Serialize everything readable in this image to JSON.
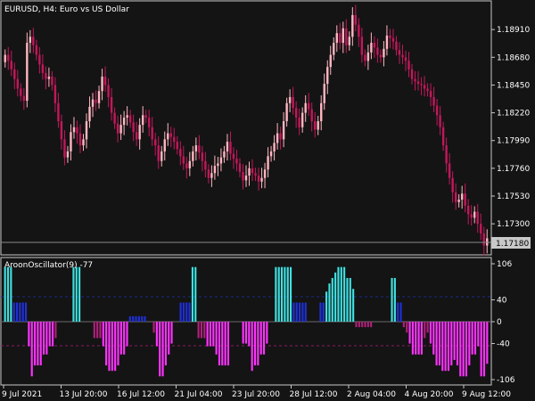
{
  "symbol_label": "EURUSD, H4:  Euro vs US Dollar",
  "indicator_label": "AroonOscillator(9) -77",
  "current_price": "1.17180",
  "colors": {
    "background": "#141414",
    "axis": "#c8c8c8",
    "candle_bull": "#ffb6c1",
    "candle_bear": "#c2185b",
    "osc_strong_up": "#40e0e0",
    "osc_up": "#1f30d8",
    "osc_down": "#ff33ff",
    "osc_weak_down": "#b0207a",
    "level_up": "#1a2a8a",
    "level_down": "#8a1a6a"
  },
  "chart_data": [
    {
      "type": "candlestick",
      "title": "",
      "price_ticks": [
        "1.18910",
        "1.18680",
        "1.18450",
        "1.18220",
        "1.17990",
        "1.17760",
        "1.17530",
        "1.17300"
      ],
      "ylim": [
        1.1705,
        1.1914
      ],
      "x_ticks": [
        "9 Jul 2021",
        "13 Jul 20:00",
        "16 Jul 12:00",
        "21 Jul 04:00",
        "23 Jul 20:00",
        "28 Jul 12:00",
        "2 Aug 04:00",
        "4 Aug 20:00",
        "9 Aug 12:00"
      ],
      "close": [
        1.187,
        1.1865,
        1.1858,
        1.185,
        1.1842,
        1.1836,
        1.1832,
        1.188,
        1.1885,
        1.1878,
        1.187,
        1.1862,
        1.1855,
        1.185,
        1.1852,
        1.1845,
        1.183,
        1.1815,
        1.18,
        1.1785,
        1.179,
        1.1806,
        1.181,
        1.1805,
        1.1795,
        1.18,
        1.1815,
        1.1827,
        1.1833,
        1.183,
        1.184,
        1.1852,
        1.1845,
        1.1835,
        1.1822,
        1.1813,
        1.1805,
        1.1812,
        1.1818,
        1.182,
        1.1814,
        1.1806,
        1.18,
        1.1812,
        1.182,
        1.1818,
        1.181,
        1.18,
        1.1795,
        1.1782,
        1.179,
        1.18,
        1.1805,
        1.1802,
        1.1798,
        1.1792,
        1.1786,
        1.178,
        1.1776,
        1.1782,
        1.179,
        1.1795,
        1.1789,
        1.1782,
        1.1775,
        1.1768,
        1.1772,
        1.1778,
        1.178,
        1.1785,
        1.179,
        1.1798,
        1.1788,
        1.1784,
        1.178,
        1.1773,
        1.1766,
        1.177,
        1.1776,
        1.1772,
        1.177,
        1.1765,
        1.1768,
        1.1775,
        1.1786,
        1.179,
        1.1797,
        1.1805,
        1.18,
        1.1815,
        1.183,
        1.1835,
        1.1826,
        1.1818,
        1.181,
        1.1822,
        1.183,
        1.1825,
        1.1815,
        1.1808,
        1.1815,
        1.183,
        1.1846,
        1.186,
        1.187,
        1.188,
        1.1888,
        1.188,
        1.1892,
        1.1878,
        1.1885,
        1.1903,
        1.1895,
        1.1885,
        1.187,
        1.1865,
        1.1872,
        1.188,
        1.1876,
        1.187,
        1.1868,
        1.1875,
        1.1886,
        1.1884,
        1.1881,
        1.1874,
        1.187,
        1.1868,
        1.1865,
        1.1858,
        1.185,
        1.1848,
        1.1846,
        1.1845,
        1.1842,
        1.184,
        1.1835,
        1.1828,
        1.182,
        1.181,
        1.1795,
        1.178,
        1.1768,
        1.1756,
        1.1748,
        1.175,
        1.1755,
        1.1745,
        1.1738,
        1.1735,
        1.174,
        1.173,
        1.1722,
        1.1712,
        1.1718
      ]
    },
    {
      "type": "bar",
      "title": "AroonOscillator(9)",
      "y_ticks": [
        "106",
        "40",
        "0",
        "-40",
        "-106"
      ],
      "ylim": [
        -106,
        106
      ],
      "levels": [
        40,
        -40
      ],
      "values": [
        100,
        100,
        100,
        35,
        35,
        35,
        35,
        35,
        -45,
        -100,
        -80,
        -80,
        -80,
        -60,
        -60,
        -45,
        -45,
        -30,
        0,
        0,
        0,
        0,
        0,
        100,
        100,
        100,
        0,
        0,
        0,
        0,
        -30,
        -30,
        -30,
        -45,
        -80,
        -90,
        -90,
        -90,
        -80,
        -60,
        -60,
        -45,
        10,
        10,
        10,
        10,
        10,
        10,
        0,
        0,
        -20,
        -45,
        -100,
        -100,
        -80,
        -60,
        -40,
        0,
        0,
        35,
        35,
        35,
        35,
        100,
        100,
        -30,
        -30,
        -30,
        -45,
        -45,
        -45,
        -60,
        -80,
        -80,
        -80,
        -80,
        0,
        0,
        0,
        0,
        -40,
        -40,
        -45,
        -90,
        -80,
        -80,
        -60,
        -60,
        -40,
        0,
        0,
        100,
        100,
        100,
        100,
        100,
        100,
        35,
        35,
        35,
        35,
        35,
        0,
        0,
        0,
        0,
        35,
        35,
        55,
        70,
        80,
        90,
        100,
        100,
        100,
        80,
        80,
        60,
        -10,
        -10,
        -10,
        -10,
        -10,
        -10,
        0,
        0,
        0,
        0,
        0,
        0,
        80,
        80,
        35,
        35,
        -10,
        -20,
        -40,
        -60,
        -60,
        -60,
        -60,
        -30,
        -20,
        -40,
        -60,
        -80,
        -80,
        -90,
        -90,
        -90,
        -80,
        -70,
        -80,
        -100,
        -100,
        -100,
        -80,
        -60,
        -60,
        -45,
        -100,
        -100,
        -77
      ]
    }
  ]
}
